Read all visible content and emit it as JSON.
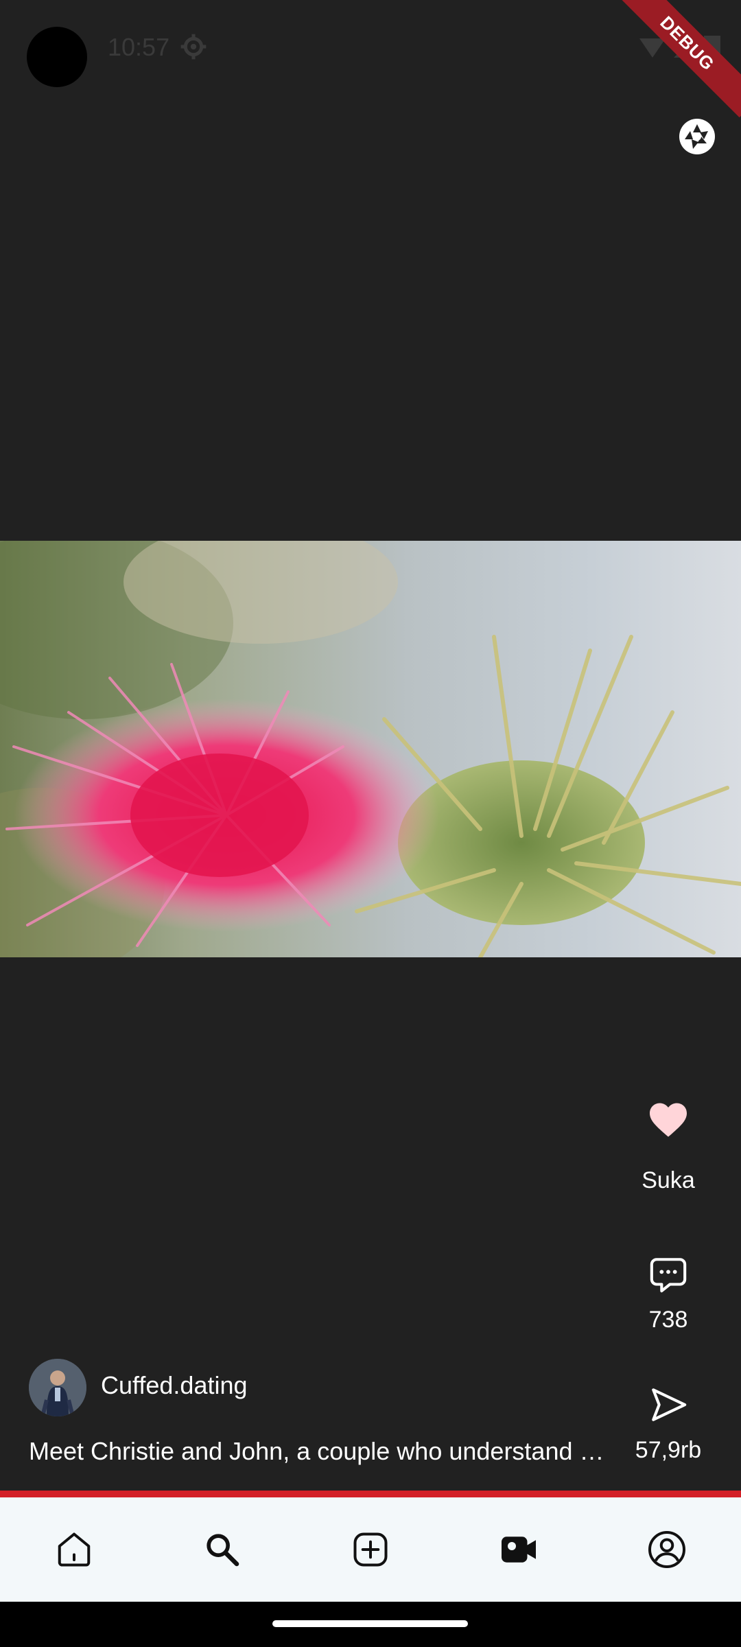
{
  "status_bar": {
    "time": "10:57",
    "debug_label": "DEBUG"
  },
  "colors": {
    "background": "#212121",
    "accent": "#d32027",
    "like": "#ffd5d9",
    "nav_background": "#f3f8fa"
  },
  "video": {
    "subject": "pink thistle flower close-up",
    "progress_fraction": 1.0
  },
  "actions": {
    "like": {
      "icon": "heart-icon",
      "label": "Suka"
    },
    "comment": {
      "icon": "comment-icon",
      "count": "738"
    },
    "share": {
      "icon": "send-icon",
      "count": "57,9rb"
    }
  },
  "post": {
    "author": "Cuffed.dating",
    "caption": "Meet Christie and John, a couple who understand each other"
  },
  "bottom_nav": {
    "items": [
      {
        "name": "home",
        "icon": "home-icon"
      },
      {
        "name": "search",
        "icon": "search-icon"
      },
      {
        "name": "create",
        "icon": "add-icon"
      },
      {
        "name": "reels",
        "icon": "video-icon",
        "active": true
      },
      {
        "name": "profile",
        "icon": "profile-icon"
      }
    ]
  }
}
